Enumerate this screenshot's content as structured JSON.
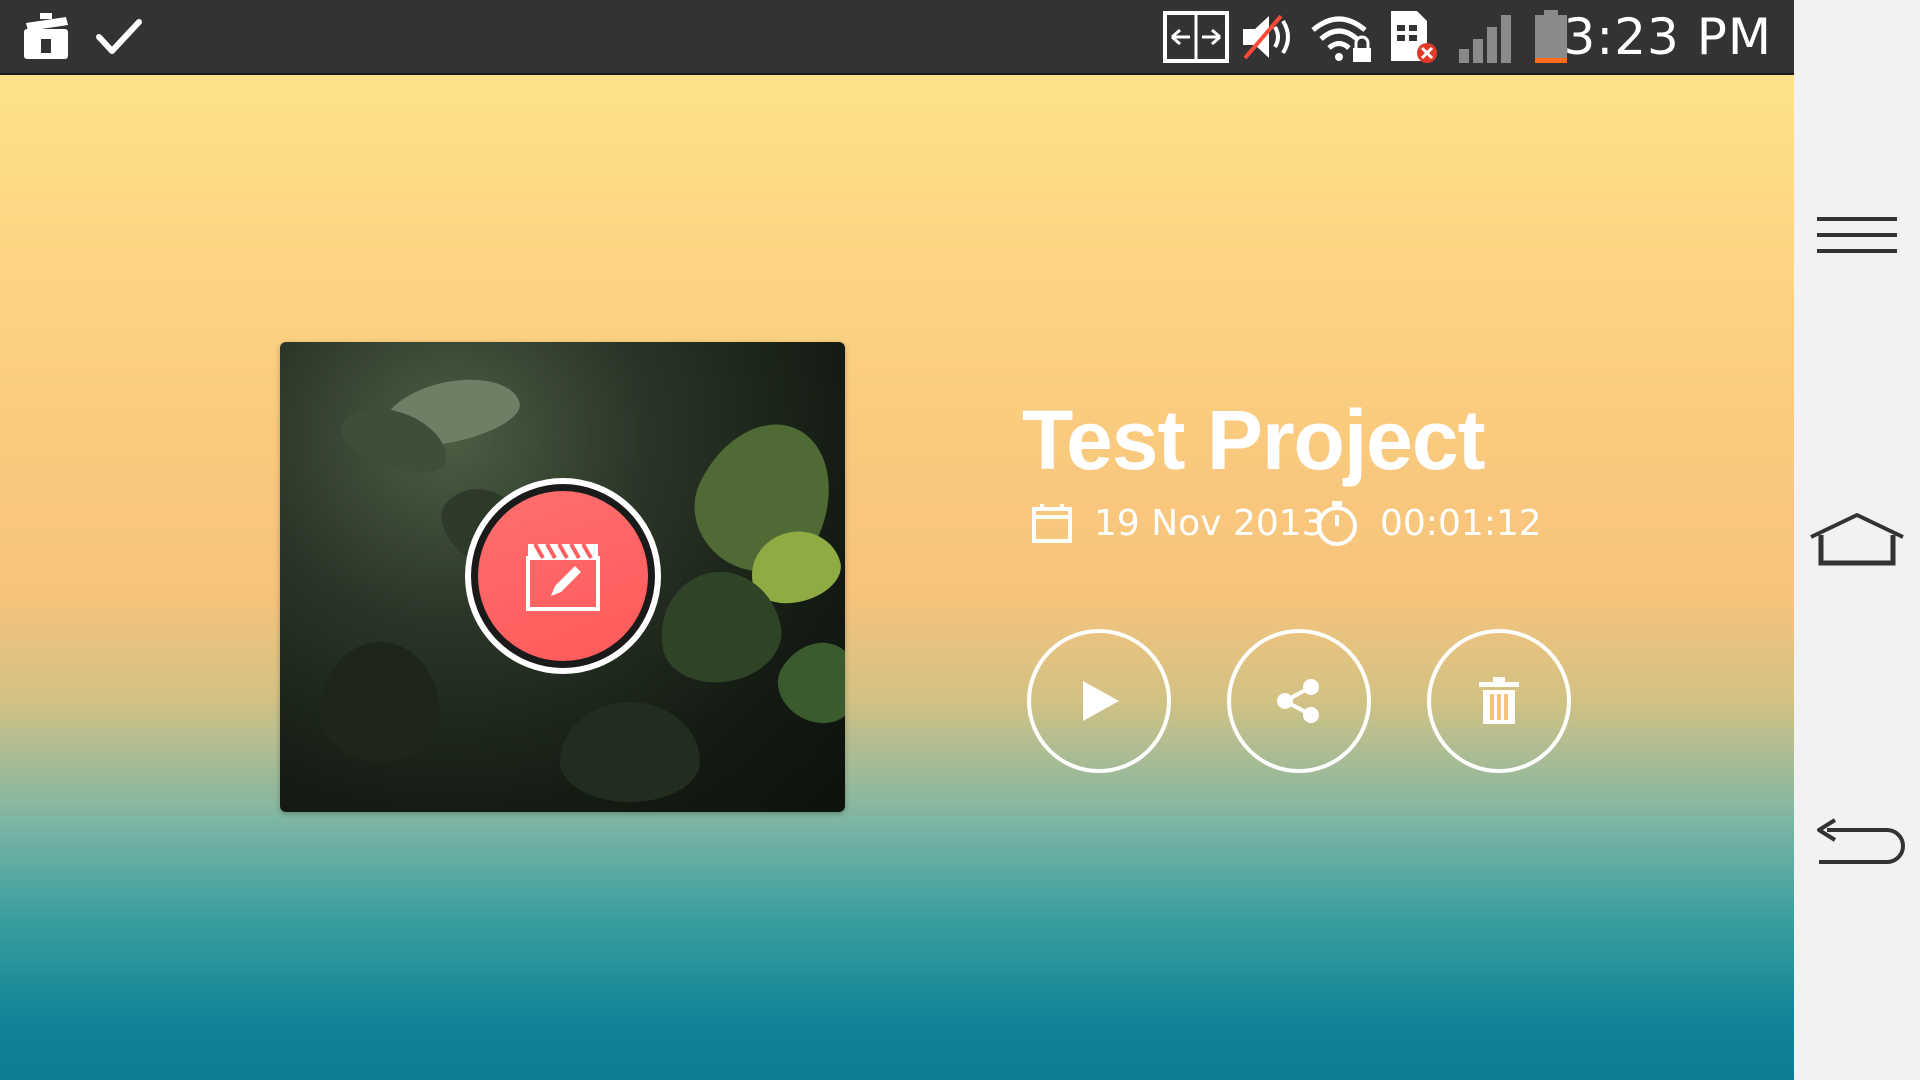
{
  "status_bar": {
    "time": "3:23 PM",
    "icons": [
      "toolbox-icon",
      "checkmark-icon",
      "screen-share-icon",
      "volume-muted-icon",
      "wifi-locked-icon",
      "sim-error-icon",
      "signal-icon",
      "battery-low-icon"
    ]
  },
  "project": {
    "title": "Test Project",
    "date": "19 Nov 2013",
    "duration": "00:01:12"
  },
  "actions": {
    "edit": "edit-icon",
    "play": "play-icon",
    "share": "share-icon",
    "delete": "trash-icon"
  },
  "colors": {
    "accent": "#ff5f5f",
    "status_bar": "#333333",
    "gradient_top": "#fee28a",
    "gradient_bottom": "#0a7d93"
  },
  "nav_bar": {
    "icons": [
      "menu-icon",
      "home-icon",
      "back-icon"
    ]
  }
}
